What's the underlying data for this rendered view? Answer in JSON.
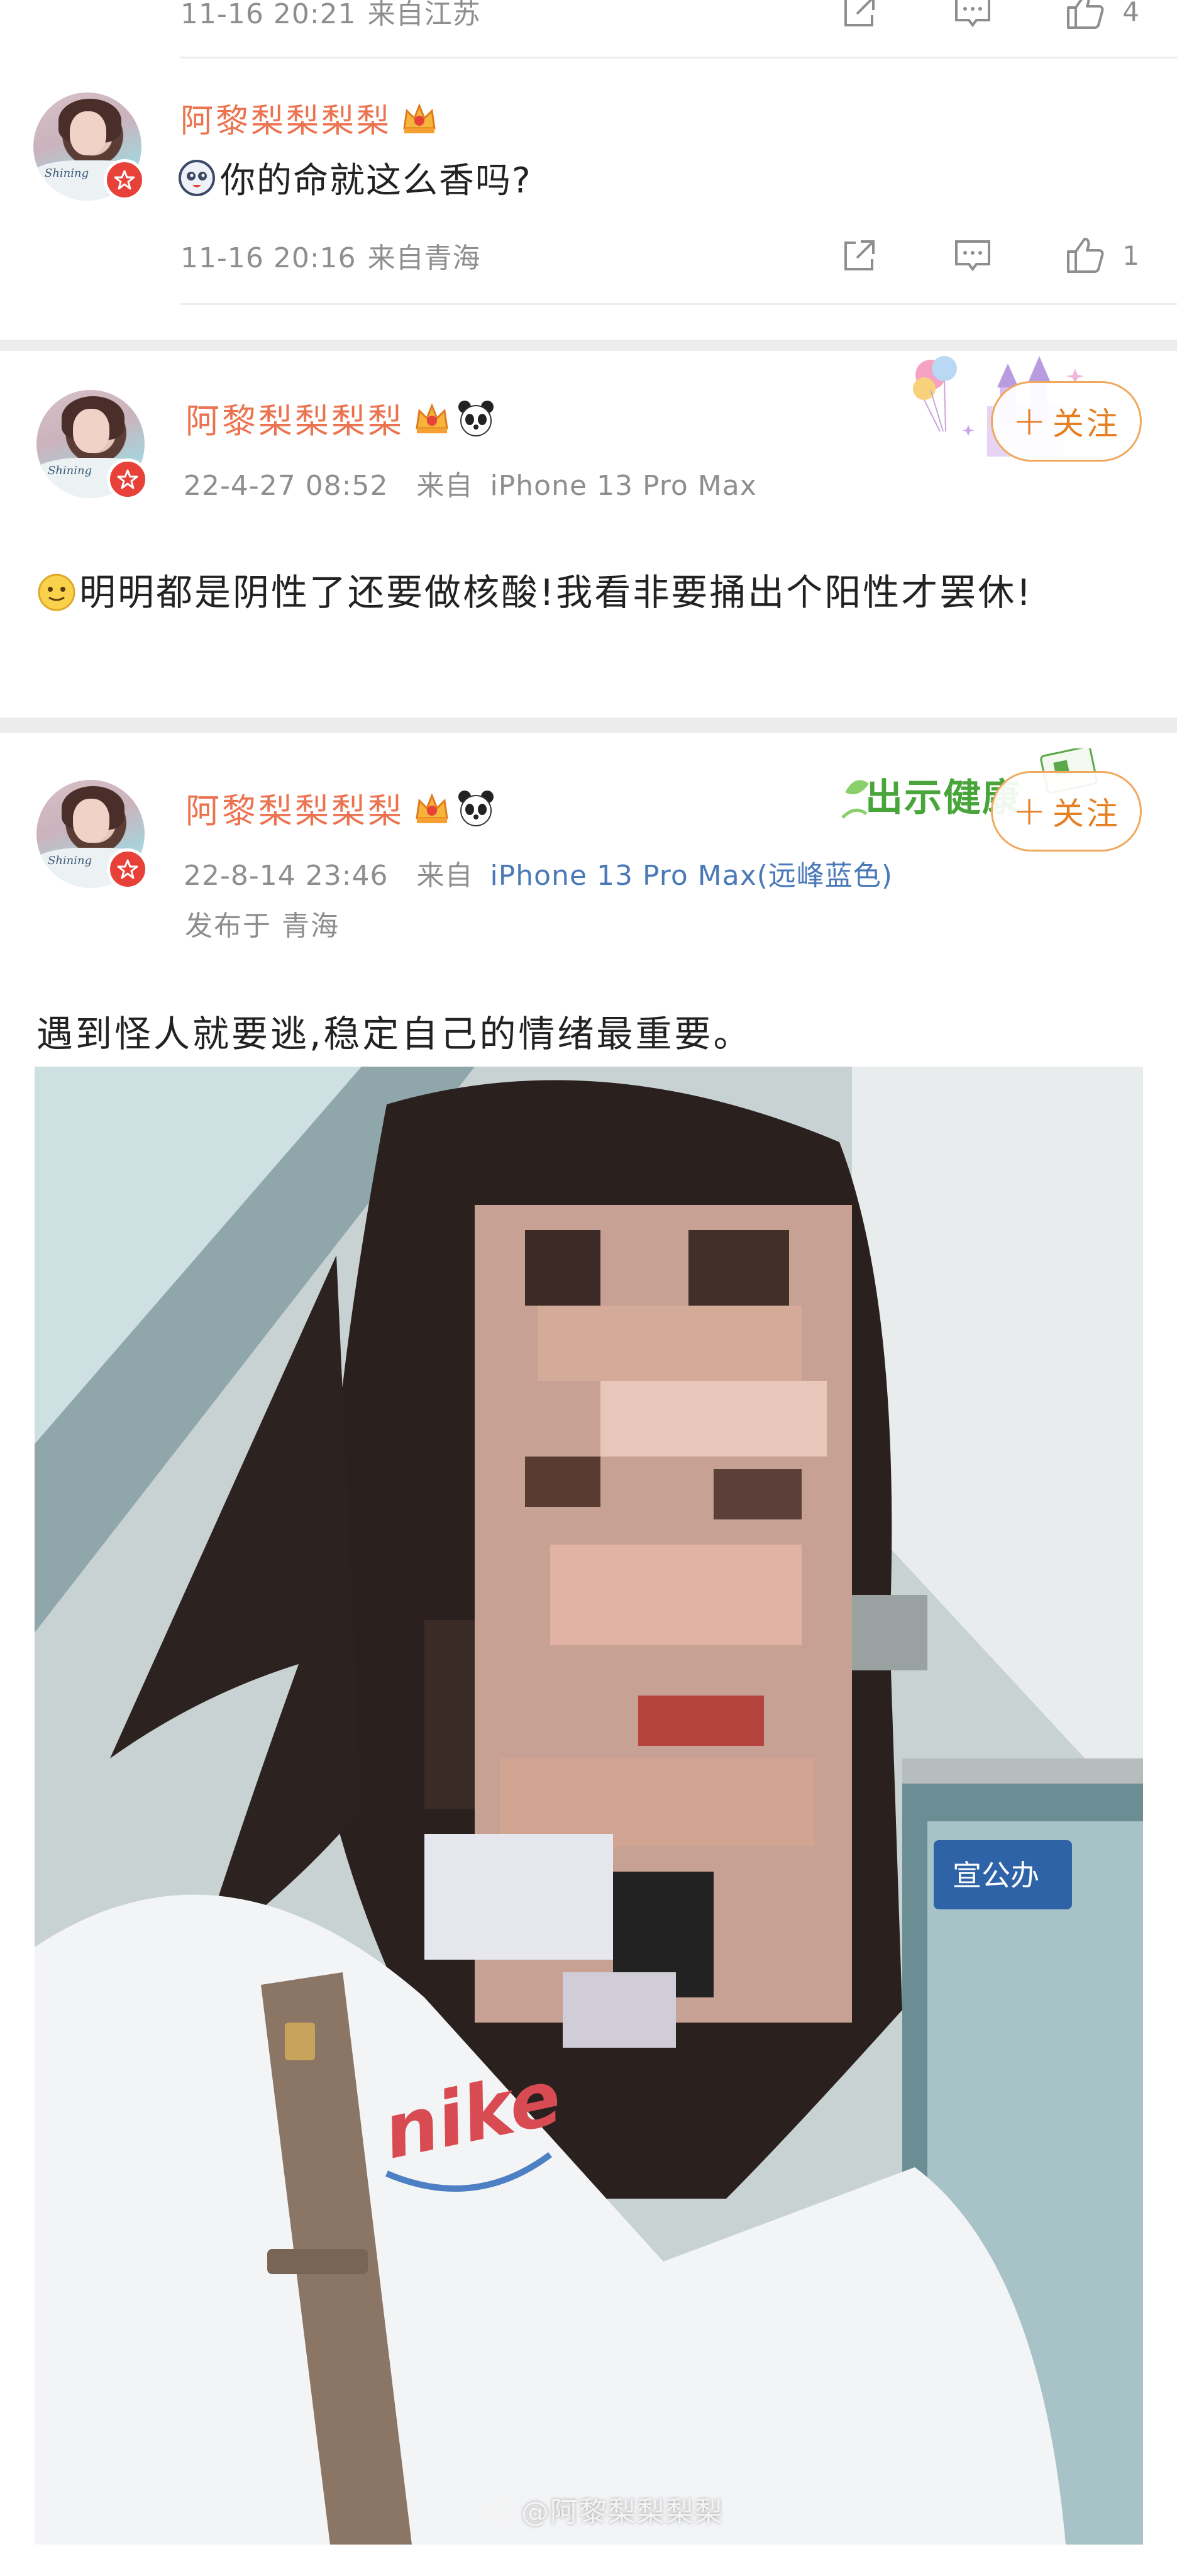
{
  "comment_top": {
    "time": "11-16 20:21",
    "source": "来自江苏",
    "like_count": "4"
  },
  "comment_2": {
    "username": "阿黎梨梨梨梨",
    "text": "你的命就这么香吗?",
    "time": "11-16 20:16",
    "source": "来自青海",
    "like_count": "1"
  },
  "post_1": {
    "username": "阿黎梨梨梨梨",
    "time": "22-4-27 08:52",
    "source_prefix": "来自",
    "source": "iPhone 13 Pro Max",
    "follow_label": "关注",
    "body": "明明都是阴性了还要做核酸!我看非要捅出个阳性才罢休!"
  },
  "post_2": {
    "username": "阿黎梨梨梨梨",
    "time": "22-8-14 23:46",
    "source_prefix": "来自",
    "source": "iPhone 13 Pro Max(远峰蓝色)",
    "location": "发布于 青海",
    "follow_label": "关注",
    "banner_text": "出示健康",
    "body": "遇到怪人就要逃,稳定自己的情绪最重要。",
    "shirt_text": "nike",
    "sign_text": "宣公办",
    "watermark": "@阿黎梨梨梨梨"
  },
  "avatar_text": "Shining",
  "colors": {
    "username": "#eb7350",
    "meta": "#8e8e8e",
    "link": "#4a79b8",
    "follow_border": "#f0a85c",
    "badge": "#e8413a"
  }
}
